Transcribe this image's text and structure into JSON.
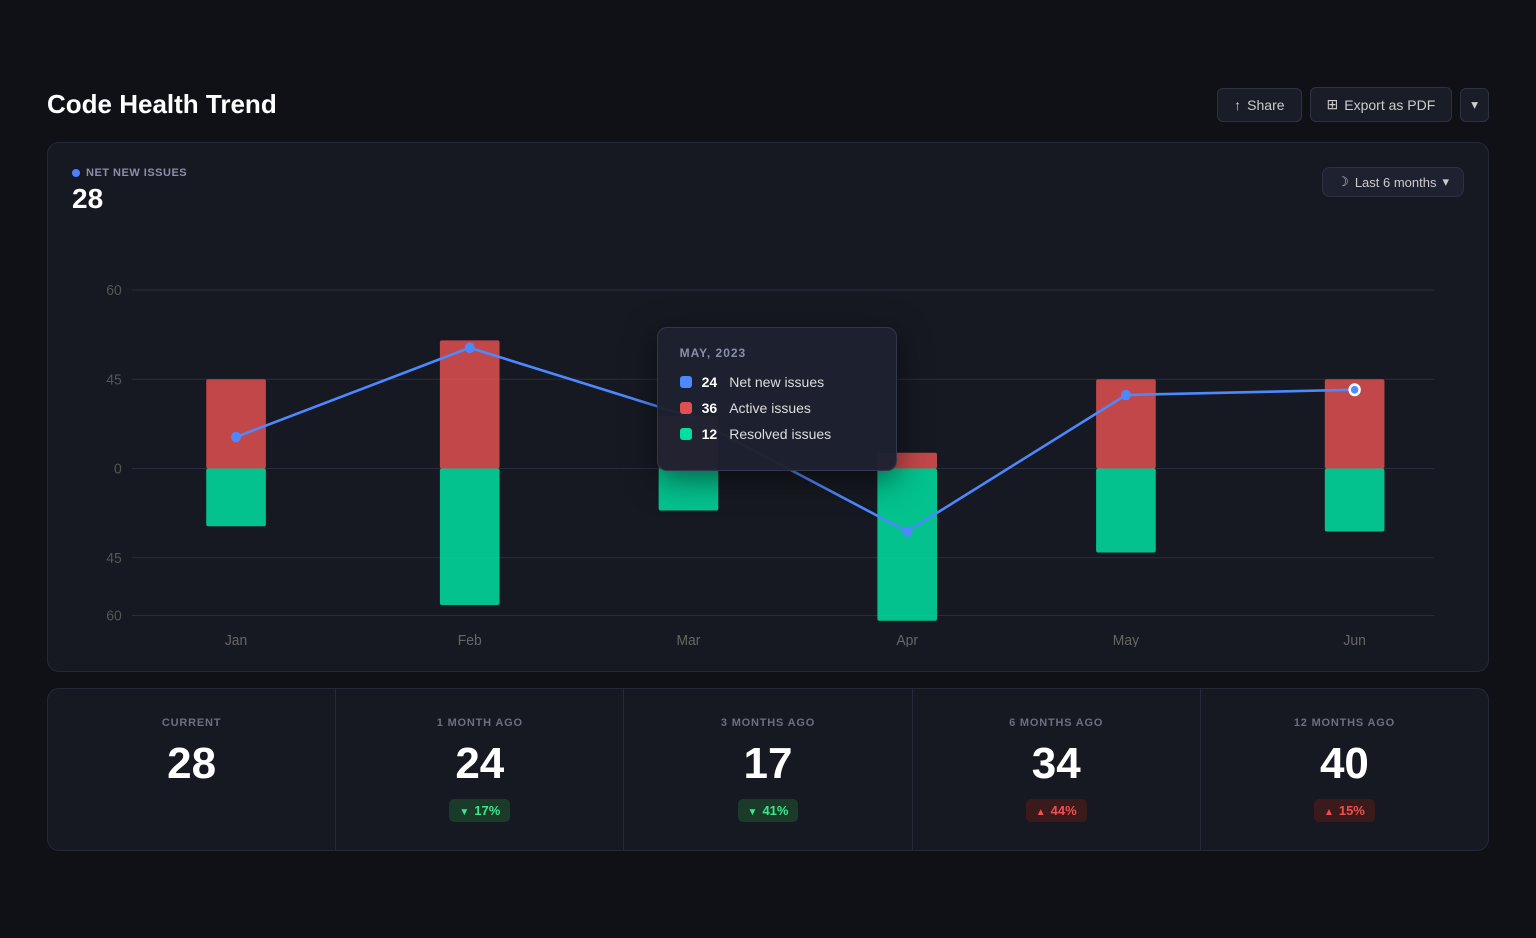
{
  "page": {
    "title": "Code Health Trend"
  },
  "header": {
    "share_label": "Share",
    "export_label": "Export as PDF"
  },
  "chart": {
    "metric_label": "NET NEW ISSUES",
    "metric_value": "28",
    "time_filter": "Last 6 months",
    "months": [
      "Jan",
      "Feb",
      "Mar",
      "Apr",
      "May",
      "Jun"
    ],
    "y_labels": [
      "60",
      "45",
      "0",
      "45",
      "60"
    ],
    "tooltip": {
      "month": "MAY, 2023",
      "net_new_label": "Net new issues",
      "net_new_value": "24",
      "active_label": "Active issues",
      "active_value": "36",
      "resolved_label": "Resolved issues",
      "resolved_value": "12"
    }
  },
  "stats": [
    {
      "label": "CURRENT",
      "value": "28",
      "badge": null,
      "badge_type": null
    },
    {
      "label": "1 MONTH AGO",
      "value": "24",
      "badge": "17%",
      "badge_type": "down"
    },
    {
      "label": "3 MONTHS AGO",
      "value": "17",
      "badge": "41%",
      "badge_type": "down"
    },
    {
      "label": "6 MONTHS AGO",
      "value": "34",
      "badge": "44%",
      "badge_type": "up"
    },
    {
      "label": "12 MONTHS AGO",
      "value": "40",
      "badge": "15%",
      "badge_type": "up"
    }
  ],
  "icons": {
    "share": "↑",
    "export": "⊞",
    "moon": "☽",
    "dropdown": "▾"
  }
}
